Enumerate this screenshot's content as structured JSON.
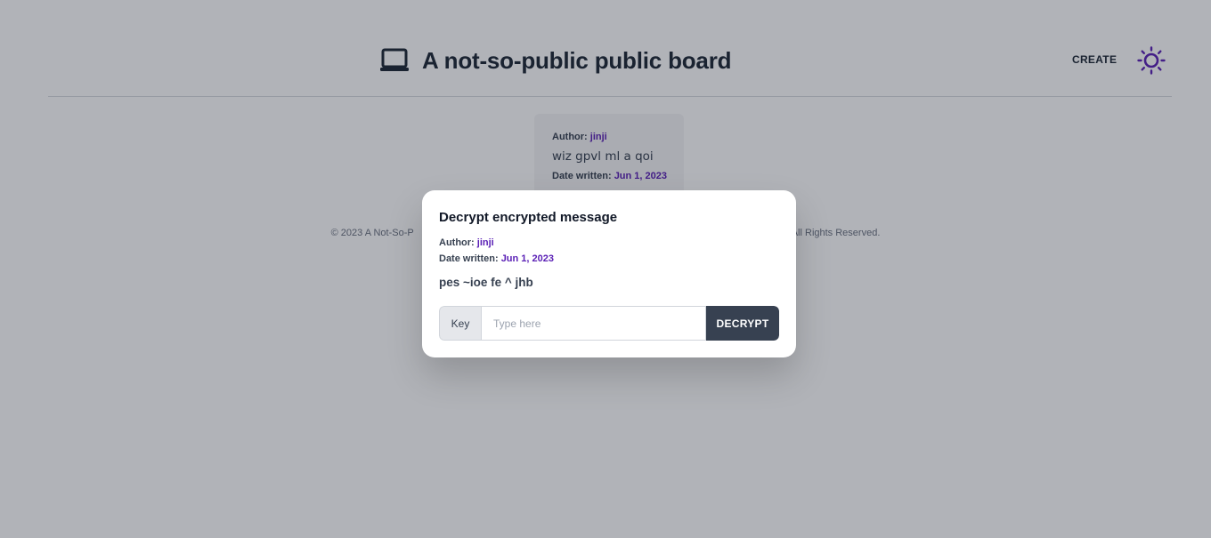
{
  "header": {
    "title": "A not-so-public public board",
    "create_label": "CREATE",
    "icon": "laptop-icon",
    "theme_icon": "sun-icon",
    "accent": "#5b21b6"
  },
  "post": {
    "author_label": "Author:",
    "author": "jinji",
    "text": "wiz gpvl ml a qoi",
    "date_label": "Date written:",
    "date": "Jun 1, 2023"
  },
  "footer": {
    "left": "© 2023 A Not-So-P",
    "right": "All Rights Reserved."
  },
  "modal": {
    "title": "Decrypt encrypted message",
    "author_label": "Author:",
    "author": "jinji",
    "date_label": "Date written:",
    "date": "Jun 1, 2023",
    "cipher_text": "pes ~ioe fe ^ jhb",
    "key_label": "Key",
    "key_value": "",
    "key_placeholder": "Type here",
    "decrypt_label": "DECRYPT"
  }
}
